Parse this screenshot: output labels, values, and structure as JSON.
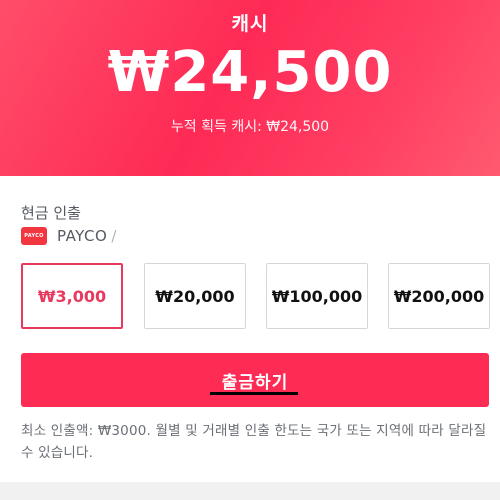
{
  "header": {
    "title": "캐시",
    "amount": "₩24,500",
    "total_label": "누적 획득 캐시: ₩24,500"
  },
  "withdrawal": {
    "section_title": "현금 인출",
    "method_logo_text": "PAYCO",
    "method_name": "PAYCO",
    "method_separator": "/",
    "options": [
      "₩3,000",
      "₩20,000",
      "₩100,000",
      "₩200,000"
    ],
    "selected_index": 0,
    "button_label": "출금하기",
    "notice": "최소 인출액: ₩3000. 월별 및 거래별 인출 한도는 국가 또는 지역에 따라 달라질 수 있습니다."
  },
  "colors": {
    "accent": "#fe2c55",
    "selected_border": "#e8395e",
    "payco_red": "#f23640"
  }
}
